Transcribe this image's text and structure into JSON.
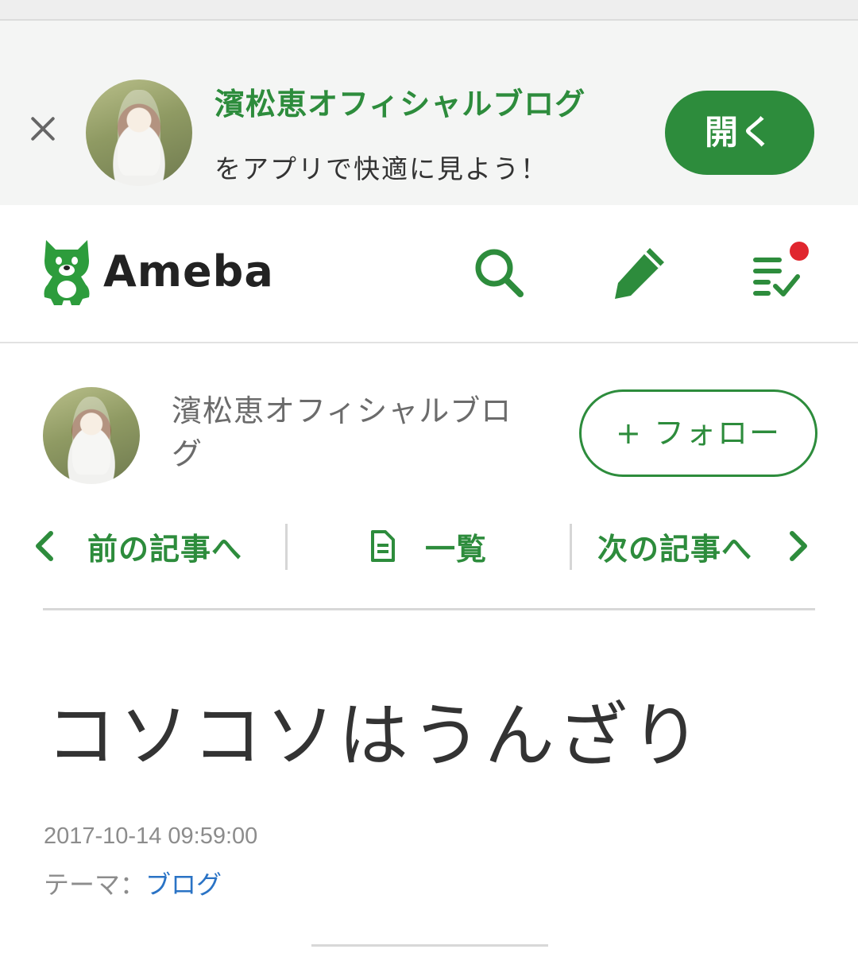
{
  "banner": {
    "title": "濱松恵オフィシャルブログ",
    "subtitle": "をアプリで快適に見よう！",
    "open_label": "開く"
  },
  "header": {
    "logo_text": "Ameba",
    "notification_color": "#e0262e"
  },
  "profile": {
    "blog_name": "濱松恵オフィシャルブログ",
    "follow_label": "+ フォロー"
  },
  "nav": {
    "prev_label": "前の記事へ",
    "list_label": "一覧",
    "next_label": "次の記事へ"
  },
  "article": {
    "title": "コソコソはうんざり",
    "date": "2017-10-14 09:59:00",
    "theme_prefix": "テーマ：",
    "theme_link": "ブログ"
  },
  "colors": {
    "brand_green": "#2d8c3c",
    "link_blue": "#2a73c5"
  },
  "icons": [
    "close-icon",
    "search-icon",
    "pen-icon",
    "checklist-icon",
    "chevron-left-icon",
    "document-icon",
    "chevron-right-icon"
  ]
}
